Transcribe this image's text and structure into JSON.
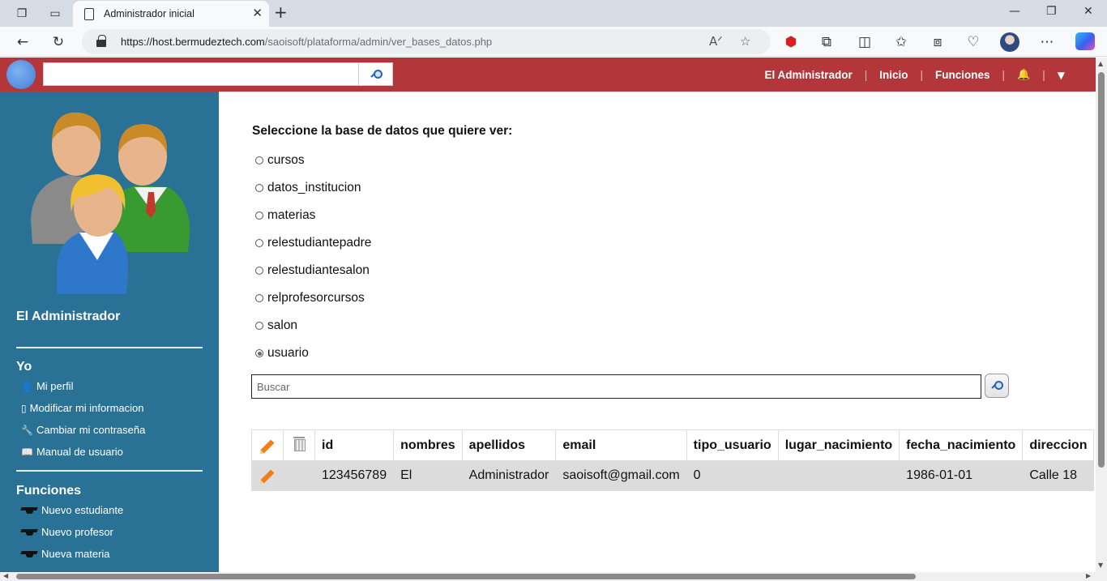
{
  "browser": {
    "tab_title": "Administrador inicial",
    "url_host": "https://host.bermudeztech.com",
    "url_path": "/saoisoft/plataforma/admin/ver_bases_datos.php"
  },
  "header": {
    "search_placeholder": "",
    "user_link": "El Administrador",
    "home_link": "Inicio",
    "functions_link": "Funciones",
    "separator": "|",
    "bell_icon": "bell-icon",
    "menu_icon": "caret-down-icon",
    "colors": {
      "header_bg": "#b3373a",
      "sidebar_bg": "#297195"
    }
  },
  "sidebar": {
    "user_name": "El Administrador",
    "section_yo": "Yo",
    "yo_items": [
      {
        "label": "Mi perfil",
        "icon": "person-icon"
      },
      {
        "label": "Modificar mi informacion",
        "icon": "document-icon"
      },
      {
        "label": "Cambiar mi contraseña",
        "icon": "wrench-icon"
      },
      {
        "label": "Manual de usuario",
        "icon": "book-icon"
      }
    ],
    "section_funciones": "Funciones",
    "funciones_items": [
      {
        "label": "Nuevo estudiante",
        "icon": "graduation-cap-icon"
      },
      {
        "label": "Nuevo profesor",
        "icon": "graduation-cap-icon"
      },
      {
        "label": "Nueva materia",
        "icon": "graduation-cap-icon"
      }
    ]
  },
  "main": {
    "prompt": "Seleccione la base de datos que quiere ver:",
    "databases": [
      {
        "label": "cursos",
        "checked": false
      },
      {
        "label": "datos_institucion",
        "checked": false
      },
      {
        "label": "materias",
        "checked": false
      },
      {
        "label": "relestudiantepadre",
        "checked": false
      },
      {
        "label": "relestudiantesalon",
        "checked": false
      },
      {
        "label": "relprofesorcursos",
        "checked": false
      },
      {
        "label": "salon",
        "checked": false
      },
      {
        "label": "usuario",
        "checked": true
      }
    ],
    "search_placeholder": "Buscar",
    "table": {
      "headers": [
        "id",
        "nombres",
        "apellidos",
        "email",
        "tipo_usuario",
        "lugar_nacimiento",
        "fecha_nacimiento",
        "direccion"
      ],
      "rows": [
        [
          "123456789",
          "El",
          "Administrador",
          "saoisoft@gmail.com",
          "0",
          "",
          "1986-01-01",
          "Calle 18"
        ]
      ]
    }
  }
}
